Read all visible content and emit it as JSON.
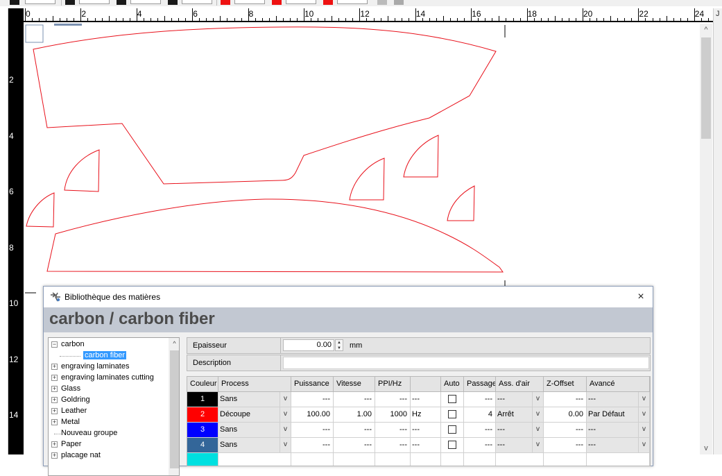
{
  "ruler": {
    "top_labels": [
      "0",
      "2",
      "4",
      "6",
      "8",
      "10",
      "12",
      "14",
      "16",
      "18",
      "20",
      "22",
      "24"
    ],
    "left_labels": [
      "2",
      "4",
      "6",
      "8",
      "10",
      "12",
      "14"
    ],
    "right_tab": "J"
  },
  "canvas": {
    "shape_color": "#e8101a"
  },
  "scrollbar": {
    "up_arrow": "^",
    "down_arrow": "v"
  },
  "dialog": {
    "title": "Bibliothèque des matières",
    "close": "×",
    "header": "carbon / carbon fiber",
    "tree": {
      "items": [
        {
          "label": "carbon",
          "expander": "−",
          "selected": false
        },
        {
          "label": "carbon fiber",
          "expander": "",
          "selected": true
        },
        {
          "label": "engraving laminates",
          "expander": "+",
          "selected": false
        },
        {
          "label": "engraving laminates cutting",
          "expander": "+",
          "selected": false
        },
        {
          "label": "Glass",
          "expander": "+",
          "selected": false
        },
        {
          "label": "Goldring",
          "expander": "+",
          "selected": false
        },
        {
          "label": "Leather",
          "expander": "+",
          "selected": false
        },
        {
          "label": "Metal",
          "expander": "+",
          "selected": false
        },
        {
          "label": "Nouveau groupe",
          "expander": "",
          "selected": false
        },
        {
          "label": "Paper",
          "expander": "+",
          "selected": false
        },
        {
          "label": "placage nat",
          "expander": "+",
          "selected": false
        }
      ],
      "scroll_up": "^"
    },
    "props": {
      "epaisseur_label": "Epaisseur",
      "epaisseur_value": "0.00",
      "epaisseur_unit": "mm",
      "spin_up": "▲",
      "spin_down": "▼",
      "description_label": "Description",
      "description_value": ""
    },
    "grid": {
      "headers": [
        "Couleur",
        "Process",
        "Puissance",
        "Vitesse",
        "PPI/Hz",
        "",
        "Auto",
        "Passage",
        "Ass. d'air",
        "Z-Offset",
        "Avancé"
      ],
      "rows": [
        {
          "num": "1",
          "color": "#000000",
          "process": "Sans",
          "puissance": "---",
          "vitesse": "---",
          "ppi": "---",
          "unit": "---",
          "auto": false,
          "passage": "---",
          "air": "---",
          "zoffset": "---",
          "avance": "---"
        },
        {
          "num": "2",
          "color": "#ff0000",
          "process": "Découpe",
          "puissance": "100.00",
          "vitesse": "1.00",
          "ppi": "1000",
          "unit": "Hz",
          "auto": false,
          "passage": "4",
          "air": "Arrêt",
          "zoffset": "0.00",
          "avance": "Par Défaut"
        },
        {
          "num": "3",
          "color": "#0000ff",
          "process": "Sans",
          "puissance": "---",
          "vitesse": "---",
          "ppi": "---",
          "unit": "---",
          "auto": false,
          "passage": "---",
          "air": "---",
          "zoffset": "---",
          "avance": "---"
        },
        {
          "num": "4",
          "color": "#336699",
          "process": "Sans",
          "puissance": "---",
          "vitesse": "---",
          "ppi": "---",
          "unit": "---",
          "auto": false,
          "passage": "---",
          "air": "---",
          "zoffset": "---",
          "avance": "---"
        },
        {
          "num": "",
          "color": "#00e0e0",
          "process": "",
          "puissance": "",
          "vitesse": "",
          "ppi": "",
          "unit": "",
          "auto": false,
          "passage": "",
          "air": "",
          "zoffset": "",
          "avance": ""
        }
      ],
      "dropdown_glyph": "v"
    }
  }
}
